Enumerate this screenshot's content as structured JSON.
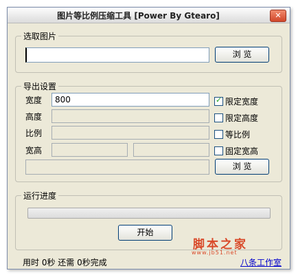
{
  "window": {
    "title": "图片等比例压缩工具 [Power By Gtearo]"
  },
  "select_group": {
    "legend": "选取图片",
    "path_value": "",
    "browse_label": "浏  览"
  },
  "export_group": {
    "legend": "导出设置",
    "width_label": "宽度",
    "width_value": "800",
    "height_label": "高度",
    "ratio_label": "比例",
    "wh_label": "宽高",
    "limit_width": "限定宽度",
    "limit_height": "限定高度",
    "proportional": "等比例",
    "fixed_wh": "固定宽高",
    "browse_label": "浏  览"
  },
  "progress_group": {
    "legend": "运行进度",
    "start_label": "开始",
    "progress": 0
  },
  "status": {
    "text": "用时 0秒 还需 0秒完成",
    "link": "八条工作室"
  },
  "watermark": {
    "main": "脚本之家",
    "sub": "www.jb51.net"
  }
}
